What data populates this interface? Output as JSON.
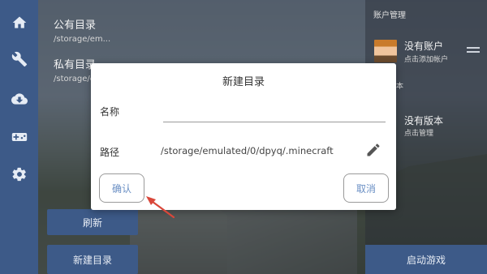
{
  "nav": {
    "items": [
      {
        "icon": "home-icon"
      },
      {
        "icon": "wrench-icon"
      },
      {
        "icon": "cloud-download-icon"
      },
      {
        "icon": "gamepad-icon"
      },
      {
        "icon": "gear-icon"
      }
    ]
  },
  "directories": [
    {
      "title": "公有目录",
      "path": "/storage/em..."
    },
    {
      "title": "私有目录",
      "path": "/storage/e..."
    }
  ],
  "panel_buttons": {
    "refresh": "刷新",
    "new_dir": "新建目录"
  },
  "account": {
    "header": "账户管理",
    "name": "没有账户",
    "sub": "点击添加帐户",
    "version_fragment": "本",
    "version_name": "没有版本",
    "version_sub": "点击管理"
  },
  "launch_label": "启动游戏",
  "dialog": {
    "title": "新建目录",
    "name_label": "名称",
    "name_value": "",
    "path_label": "路径",
    "path_value": "/storage/emulated/0/dpyq/.minecraft",
    "confirm": "确认",
    "cancel": "取消"
  },
  "colors": {
    "accent": "#3d5a88",
    "button_text": "#6a8fc4",
    "annotation": "#d9473a"
  }
}
